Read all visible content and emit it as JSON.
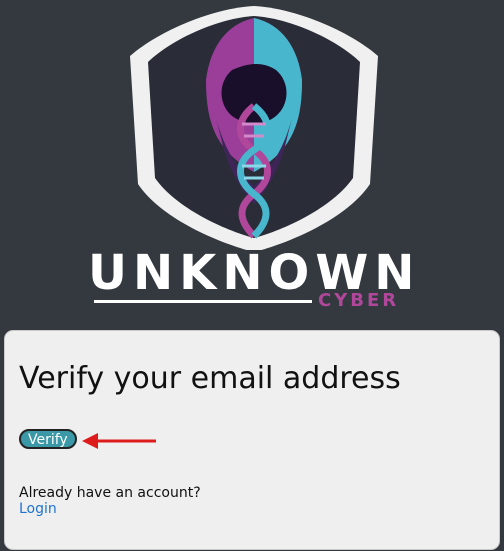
{
  "logo": {
    "name": "UNKNOWN",
    "tagline": "CYBER"
  },
  "card": {
    "title": "Verify your email address",
    "verify_label": "Verify",
    "account_prompt": "Already have an account?",
    "login_label": "Login"
  },
  "colors": {
    "background": "#343940",
    "card": "#efefef",
    "verify_button": "#3b98a6",
    "link": "#1f74ce",
    "logo_purple": "#b1479b",
    "logo_teal": "#48b6cc"
  },
  "icons": [
    "hooded-dna-shield-logo-icon",
    "red-arrow-icon"
  ]
}
